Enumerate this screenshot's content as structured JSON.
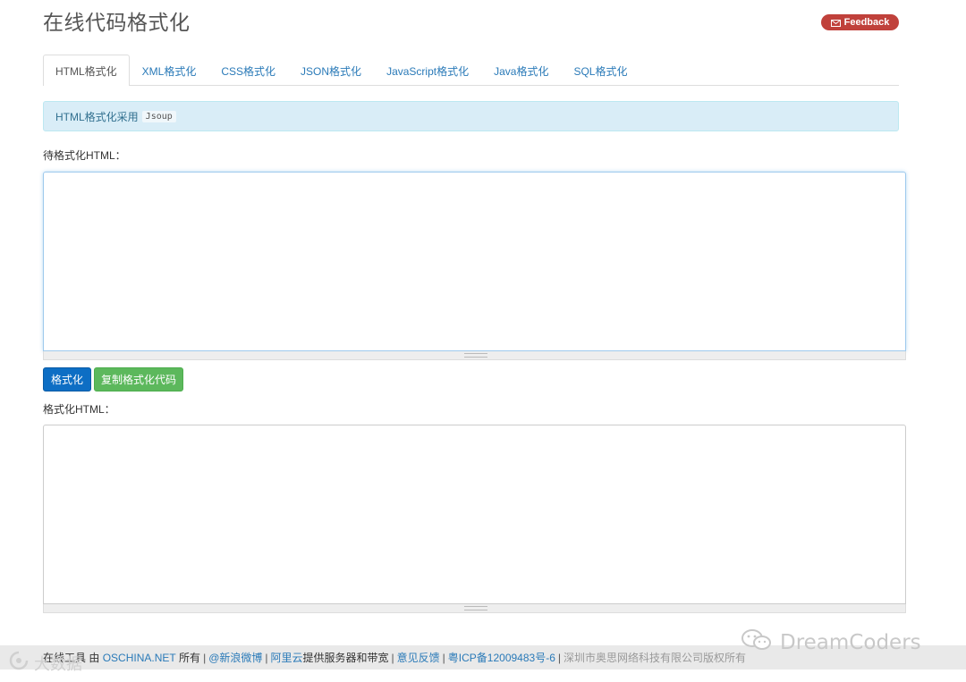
{
  "header": {
    "title": "在线代码格式化",
    "feedback_label": "Feedback",
    "feedback_color": "#c0413b"
  },
  "tabs": [
    {
      "label": "HTML格式化",
      "active": true
    },
    {
      "label": "XML格式化",
      "active": false
    },
    {
      "label": "CSS格式化",
      "active": false
    },
    {
      "label": "JSON格式化",
      "active": false
    },
    {
      "label": "JavaScript格式化",
      "active": false
    },
    {
      "label": "Java格式化",
      "active": false
    },
    {
      "label": "SQL格式化",
      "active": false
    }
  ],
  "info": {
    "text": "HTML格式化采用",
    "code": "Jsoup"
  },
  "input": {
    "label": "待格式化HTML：",
    "value": "",
    "placeholder": ""
  },
  "buttons": {
    "format_label": "格式化",
    "copy_label": "复制格式化代码",
    "format_color": "#0d6ec4",
    "copy_color": "#5cb85c"
  },
  "output": {
    "label": "格式化HTML：",
    "value": ""
  },
  "footer": {
    "prefix": "在线工具 由",
    "oschina": "OSCHINA.NET",
    "owned": "所有",
    "weibo": "@新浪微博",
    "aliyun": "阿里云",
    "aliyun_suffix": "提供服务器和带宽",
    "feedback": "意见反馈",
    "icp": "粤ICP备12009483号-6",
    "copyright": "深圳市奥思网络科技有限公司版权所有"
  },
  "watermarks": {
    "right": "DreamCoders",
    "left": "大数据"
  },
  "icons": {
    "feedback": "mail-icon",
    "watermark_right": "wechat-icon",
    "watermark_left": "logo-icon"
  }
}
